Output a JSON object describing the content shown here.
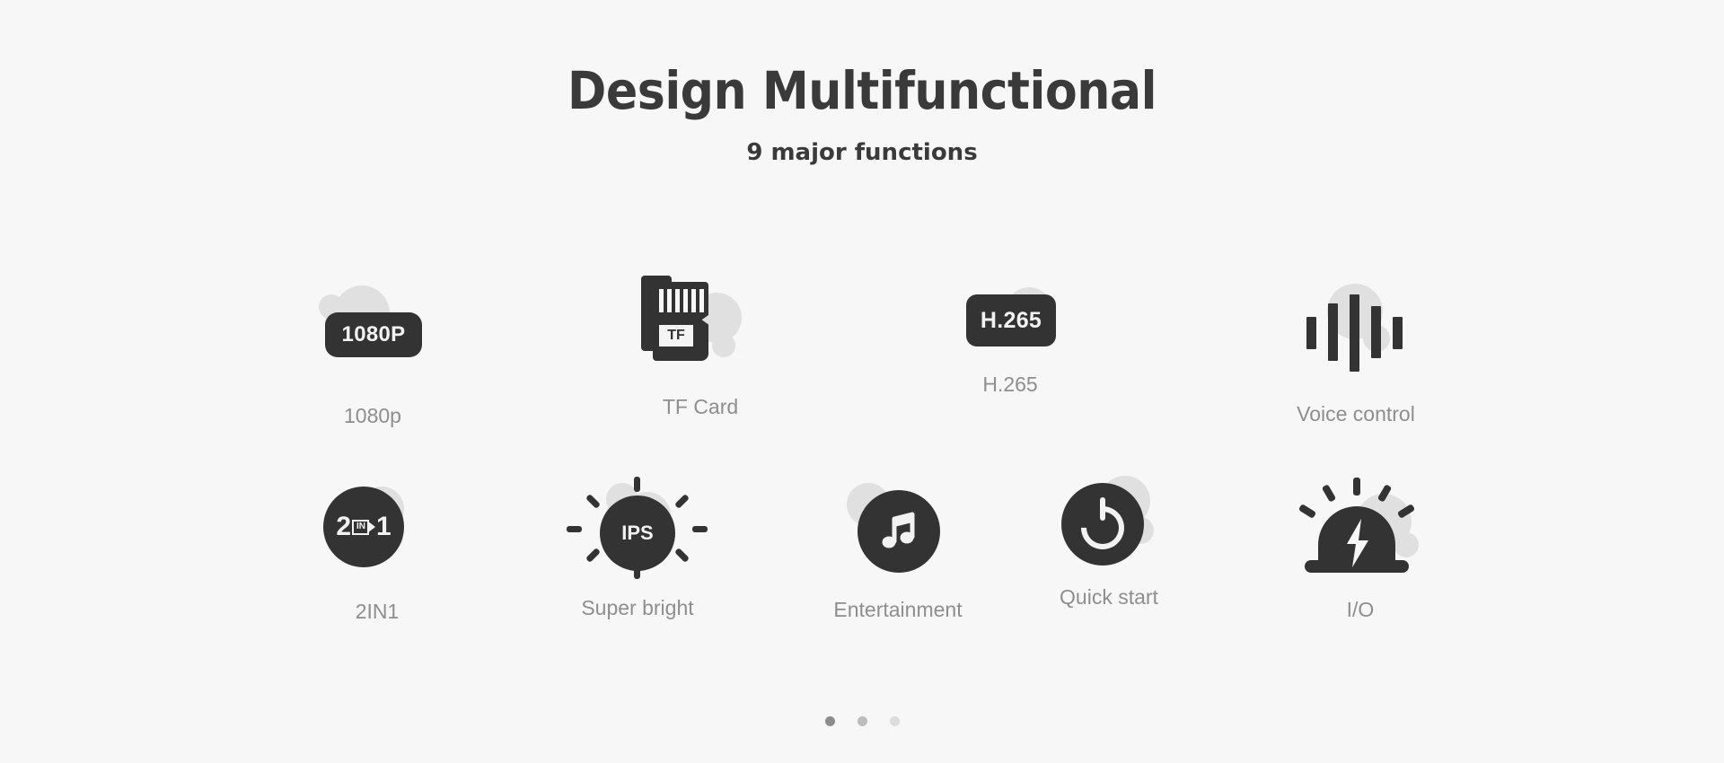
{
  "heading": {
    "title": "Design Multifunctional",
    "subtitle": "9 major functions"
  },
  "colors": {
    "background": "#f7f7f7",
    "dark": "#333333",
    "label": "#8e8e8e",
    "blob": "#e0e0e0",
    "title": "#3a3a3a"
  },
  "features": [
    {
      "label": "1080p",
      "icon": "badge-1080p-icon",
      "badge_text": "1080P"
    },
    {
      "label": "TF Card",
      "icon": "tf-card-icon",
      "badge_text": "TF"
    },
    {
      "label": "H.265",
      "icon": "badge-h265-icon",
      "badge_text": "H.265"
    },
    {
      "label": "Voice control",
      "icon": "voice-waveform-icon",
      "badge_text": ""
    },
    {
      "label": "2IN1",
      "icon": "two-in-one-icon",
      "badge_text": "2IN1"
    },
    {
      "label": "Super bright",
      "icon": "ips-brightness-icon",
      "badge_text": "IPS"
    },
    {
      "label": "Entertainment",
      "icon": "music-note-icon",
      "badge_text": ""
    },
    {
      "label": "Quick start",
      "icon": "power-button-icon",
      "badge_text": ""
    },
    {
      "label": "I/O",
      "icon": "siren-bolt-icon",
      "badge_text": ""
    }
  ],
  "pagination": {
    "dots": [
      {
        "state": "active",
        "color": "#8c8c8c"
      },
      {
        "state": "inactive",
        "color": "#bdbdbd"
      },
      {
        "state": "inactive",
        "color": "#dcdcdc"
      }
    ]
  }
}
